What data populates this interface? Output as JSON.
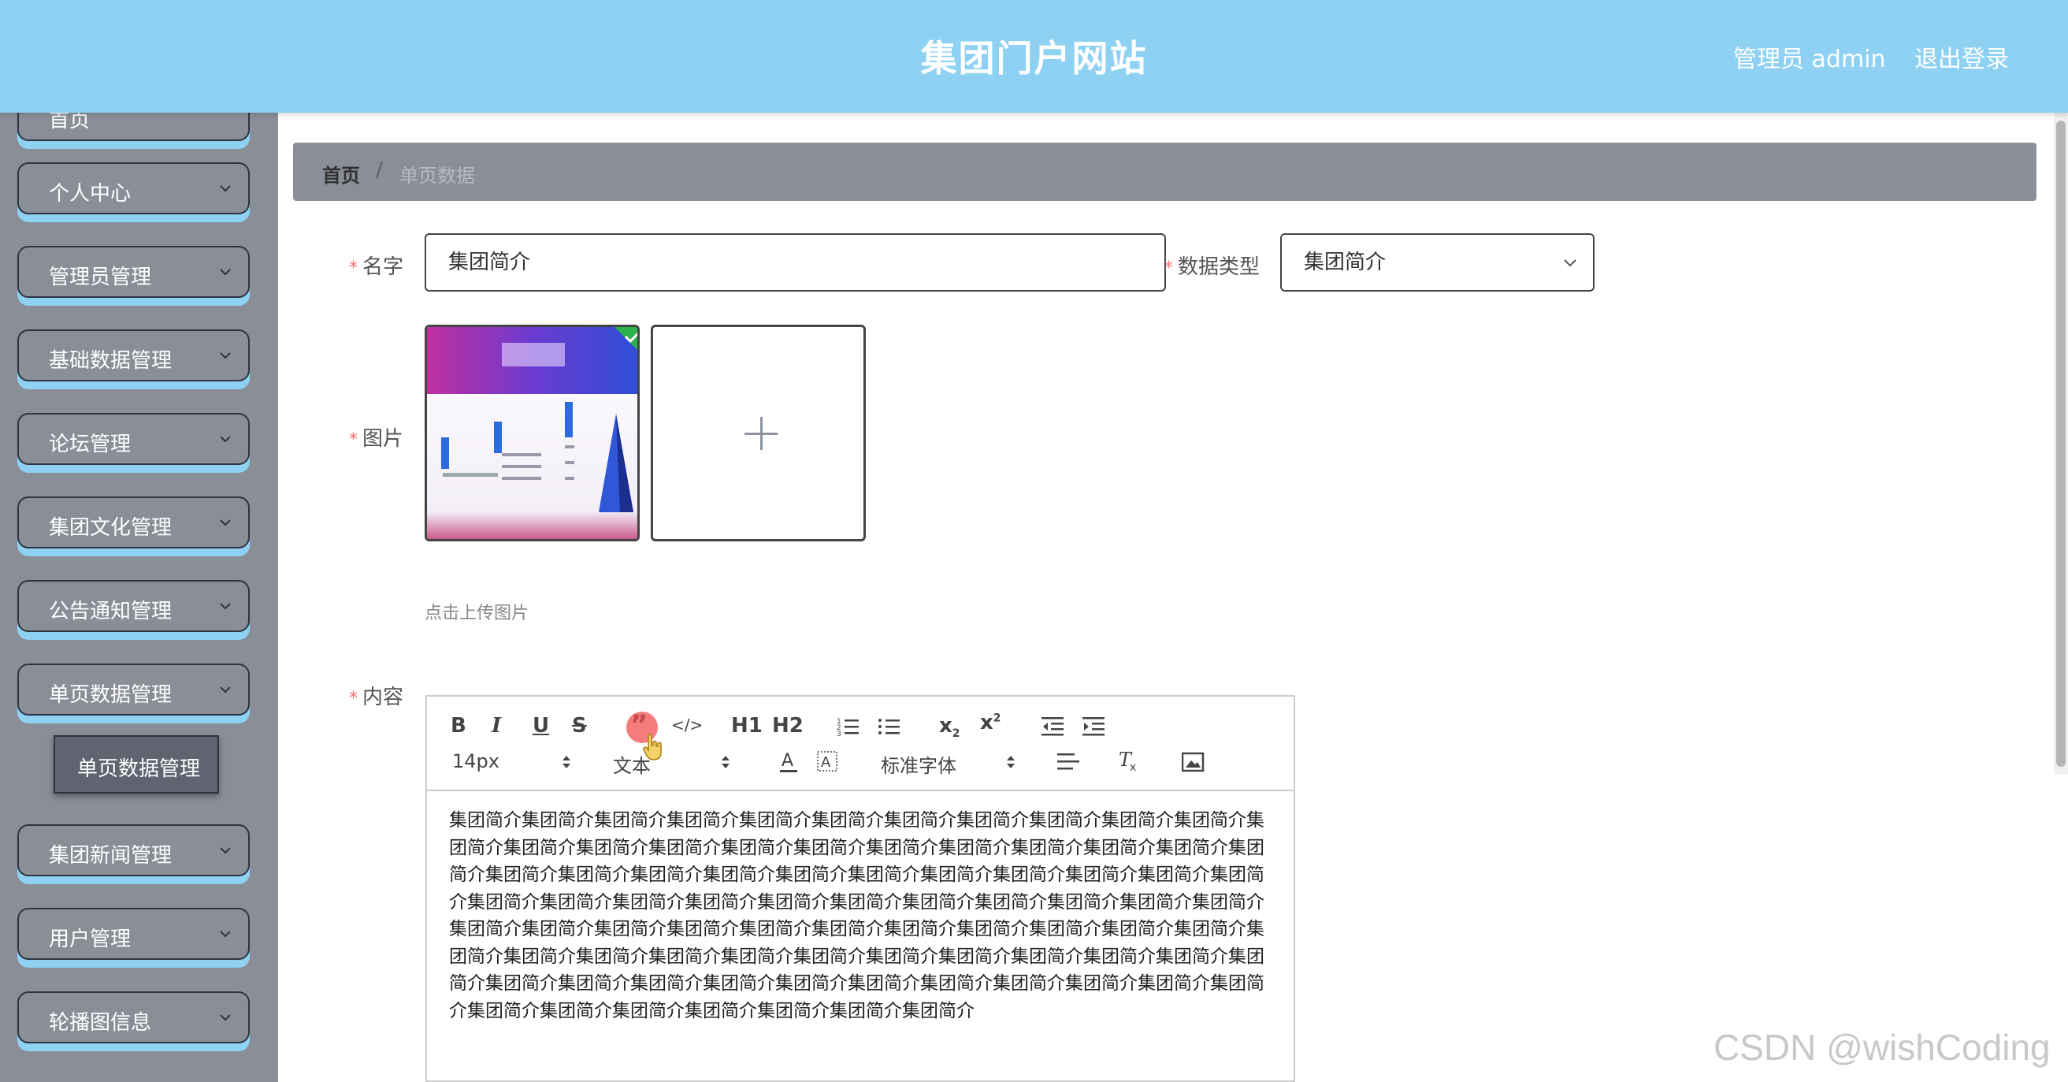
{
  "header": {
    "title": "集团门户网站",
    "admin_label": "管理员 admin",
    "logout_label": "退出登录",
    "bg_color": "#8ed1f3"
  },
  "sidebar": {
    "items": [
      {
        "label": "首页"
      },
      {
        "label": "个人中心"
      },
      {
        "label": "管理员管理"
      },
      {
        "label": "基础数据管理"
      },
      {
        "label": "论坛管理"
      },
      {
        "label": "集团文化管理"
      },
      {
        "label": "公告通知管理"
      },
      {
        "label": "单页数据管理"
      },
      {
        "label": "集团新闻管理"
      },
      {
        "label": "用户管理"
      },
      {
        "label": "轮播图信息"
      }
    ],
    "submenu_label": "单页数据管理"
  },
  "breadcrumb": {
    "home": "首页",
    "separator": "/",
    "current": "单页数据"
  },
  "form": {
    "name_label": "名字",
    "name_value": "集团简介",
    "type_label": "数据类型",
    "type_value": "集团简介",
    "image_label": "图片",
    "upload_hint": "点击上传图片",
    "content_label": "内容",
    "required_mark": "*"
  },
  "editor": {
    "toolbar_row1": [
      "B",
      "I",
      "U",
      "S",
      "”",
      "</>",
      "H1",
      "H2",
      "ordered-list-icon",
      "bullet-list-icon",
      "x2-sub",
      "x2-sup",
      "outdent-icon",
      "indent-icon"
    ],
    "font_size": "14px",
    "paragraph": "文本",
    "font_family": "标准字体",
    "content": "集团简介集团简介集团简介集团简介集团简介集团简介集团简介集团简介集团简介集团简介集团简介集团简介集团简介集团简介集团简介集团简介集团简介集团简介集团简介集团简介集团简介集团简介集团简介集团简介集团简介集团简介集团简介集团简介集团简介集团简介集团简介集团简介集团简介集团简介集团简介集团简介集团简介集团简介集团简介集团简介集团简介集团简介集团简介集团简介集团简介集团简介集团简介集团简介集团简介集团简介集团简介集团简介集团简介集团简介集团简介集团简介集团简介集团简介集团简介集团简介集团简介集团简介集团简介集团简介集团简介集团简介集团简介集团简介集团简介集团简介集团简介集团简介集团简介集团简介集团简介集团简介集团简介集团简介集团简介集团简介集团简介集团简介集团简介集团简介集团简介集团简介"
  },
  "watermark": "CSDN @wishCoding"
}
